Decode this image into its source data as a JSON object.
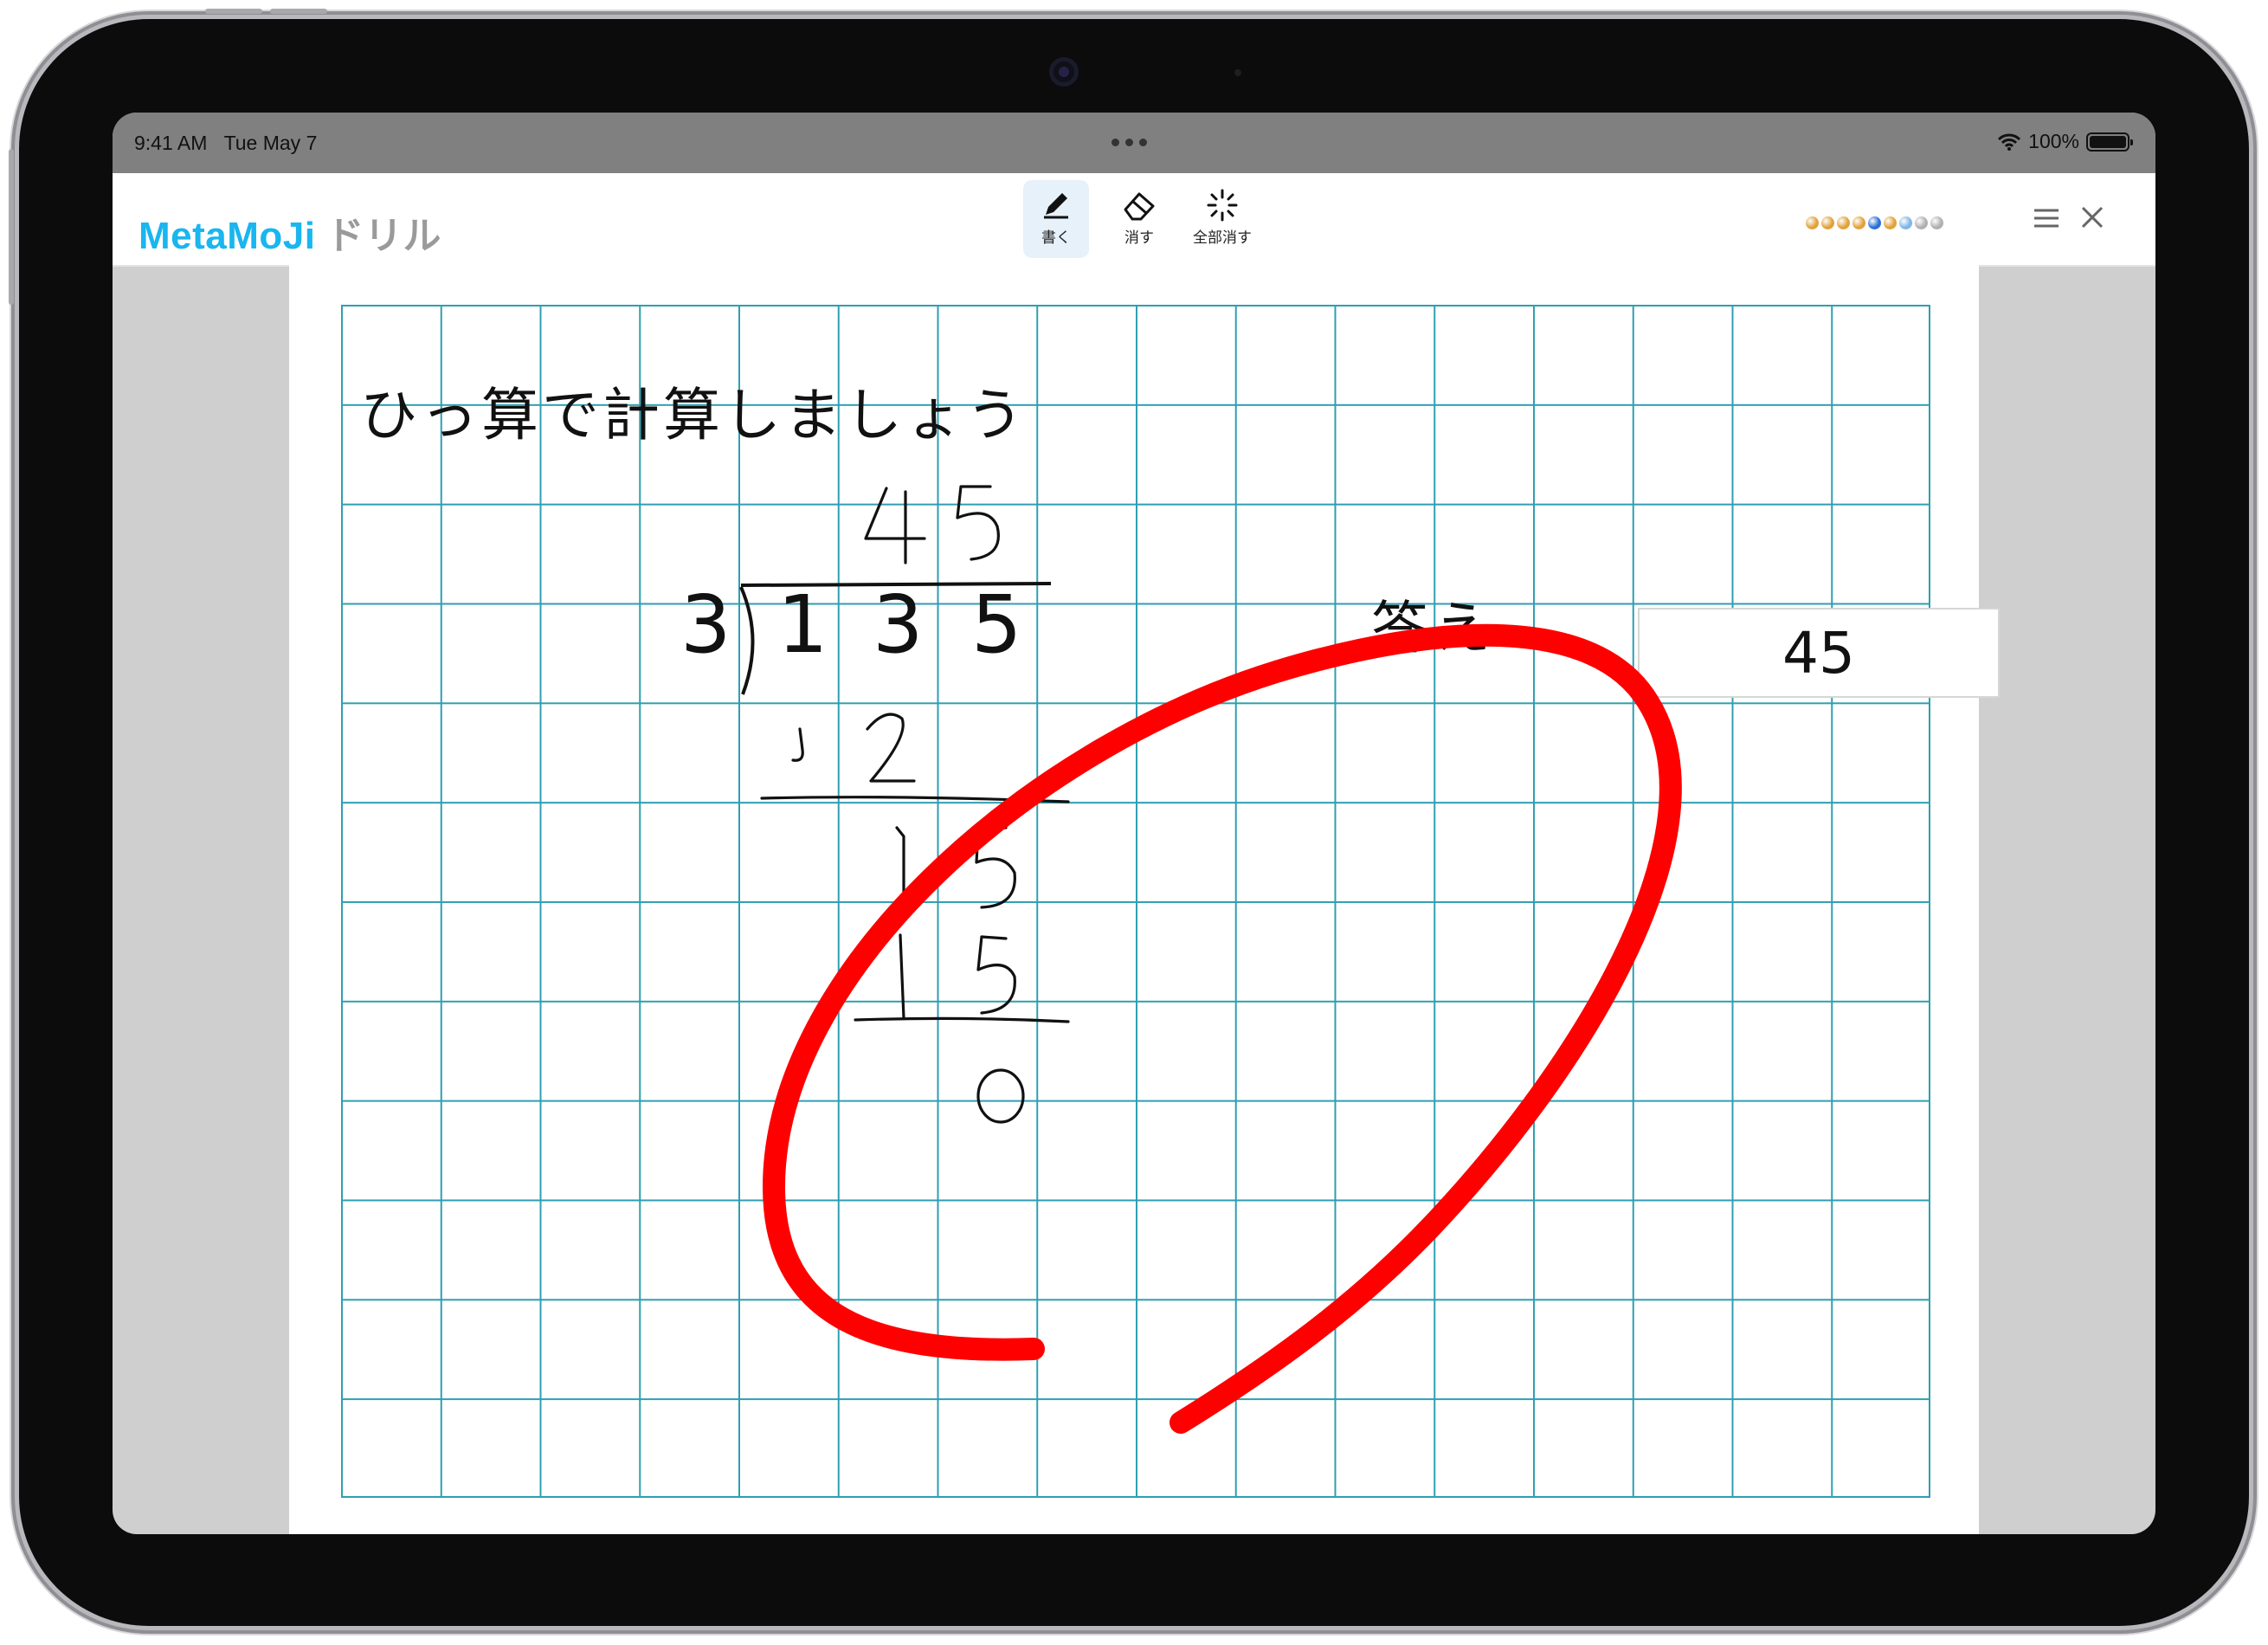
{
  "status_bar": {
    "time": "9:41 AM",
    "date": "Tue May 7",
    "battery": "100%"
  },
  "app": {
    "brand": "MetaMoJi",
    "product": "ドリル"
  },
  "tools": [
    {
      "label": "書く",
      "icon": "pencil-icon",
      "active": true
    },
    {
      "label": "消す",
      "icon": "eraser-icon",
      "active": false
    },
    {
      "label": "全部消す",
      "icon": "clear-all-icon",
      "active": false
    }
  ],
  "progress_colors": [
    "#e0a23a",
    "#e0a23a",
    "#e0a23a",
    "#e0a23a",
    "#2a6fd6",
    "#e0a23a",
    "#7fb6e6",
    "#b0b0b0",
    "#b0b0b0"
  ],
  "problem": {
    "question": "ひっ算で計算しましょう",
    "divisor": "3",
    "dividend": [
      "1",
      "3",
      "5"
    ],
    "answer_label": "答え",
    "answer_value": "45"
  },
  "handwriting": {
    "quotient": [
      "4",
      "5"
    ],
    "step_product_1": [
      "1",
      "2"
    ],
    "step_remainder_1": [
      "1",
      "5"
    ],
    "step_product_2": [
      "1",
      "5"
    ],
    "final_remainder": "0"
  },
  "colors": {
    "grid": "#2e9fb2",
    "correct_mark": "#ff0000",
    "brand": "#19b6ef"
  }
}
